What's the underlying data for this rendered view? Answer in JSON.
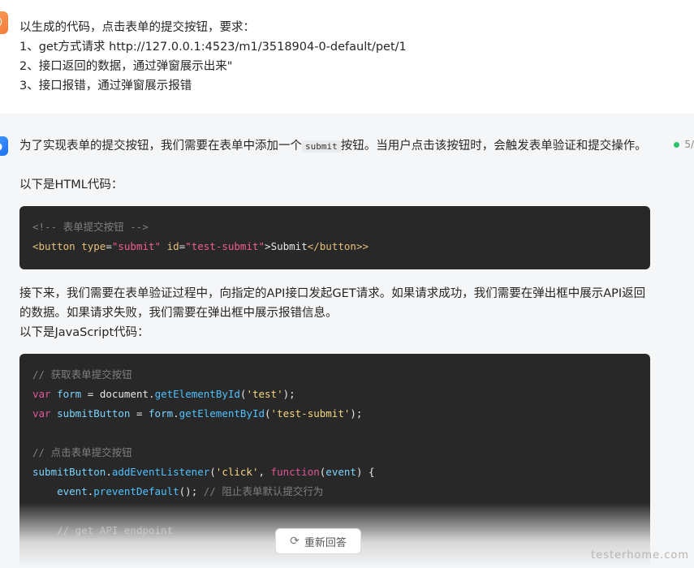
{
  "user": {
    "lines": [
      "以生成的代码，点击表单的提交按钮，要求：",
      "1、get方式请求 http://127.0.0.1:4523/m1/3518904-0-default/pet/1",
      "2、接口返回的数据，通过弹窗展示出来\"",
      "3、接口报错，通过弹窗展示报错"
    ]
  },
  "assistant": {
    "page_indicator": "5/",
    "intro_before_code": "为了实现表单的提交按钮，我们需要在表单中添加一个",
    "intro_inline_code": "submit",
    "intro_after_code": "按钮。当用户点击该按钮时，会触发表单验证和提交操作。",
    "html_heading": "以下是HTML代码：",
    "html_code": {
      "comment": "<!-- 表单提交按钮 -->",
      "open_tag": "<button",
      "attr_type": "type",
      "val_type": "\"submit\"",
      "attr_id": "id",
      "val_id": "\"test-submit\"",
      "inner": ">Submit",
      "close_tag": "</button>"
    },
    "para2": "接下来，我们需要在表单验证过程中，向指定的API接口发起GET请求。如果请求成功，我们需要在弹出框中展示API返回的数据。如果请求失败，我们需要在弹出框中展示报错信息。",
    "js_heading": "以下是JavaScript代码：",
    "js_code": {
      "c1": "// 获取表单提交按钮",
      "var": "var",
      "form": "form",
      "eq": "=",
      "document": "document",
      "getById": "getElementById",
      "s_test": "'test'",
      "submitButton": "submitButton",
      "s_test_submit": "'test-submit'",
      "c2": "// 点击表单提交按钮",
      "addEventListener": "addEventListener",
      "s_click": "'click'",
      "function": "function",
      "event": "event",
      "preventDefault": "preventDefault",
      "c3": "// 阻止表单默认提交行为",
      "c4": "// get API endpoint"
    },
    "regenerate_label": "重新回答"
  },
  "watermark": "testerhome.com"
}
